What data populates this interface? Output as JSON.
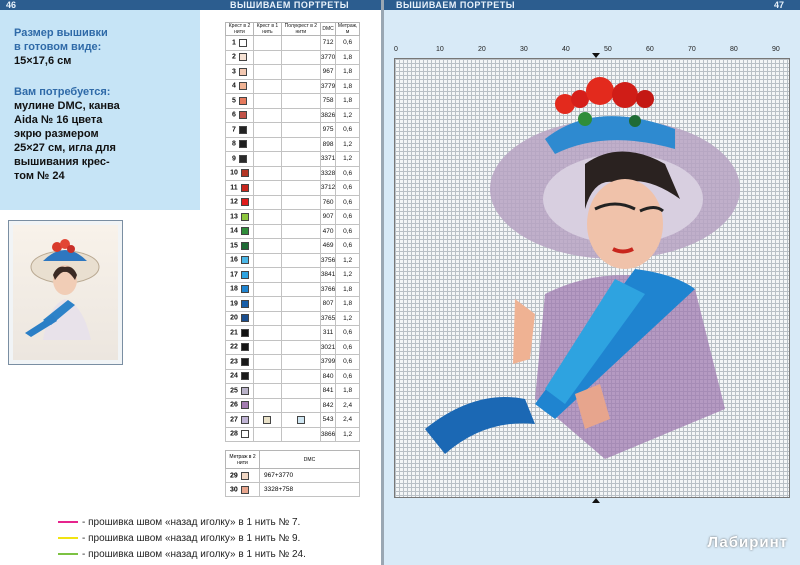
{
  "left_page": {
    "page_number": "46",
    "running_title": "ВЫШИВАЕМ ПОРТРЕТЫ",
    "info": {
      "size_title": "Размер вышивки",
      "size_sub": "в готовом виде:",
      "size_value": "15×17,6 см",
      "needs_title": "Вам потребуется:",
      "needs_lines": [
        "мулине DMC, канва",
        "Aida № 16 цвета",
        "экрю размером",
        "25×27 см, игла для",
        "вышивания крес-",
        "том № 24"
      ]
    },
    "key_headers": [
      "Крест в 2 нити",
      "Крест в 1 нить",
      "Полукрест в 2 нити",
      "DMC",
      "Метраж, м"
    ],
    "key_rows": [
      {
        "n": "1",
        "color": "#ffffff",
        "dmc": "712",
        "m": "0,6"
      },
      {
        "n": "2",
        "color": "#f6e2d4",
        "dmc": "3770",
        "m": "1,8"
      },
      {
        "n": "3",
        "color": "#f3c8b1",
        "dmc": "967",
        "m": "1,8"
      },
      {
        "n": "4",
        "color": "#efb293",
        "dmc": "3779",
        "m": "1,8"
      },
      {
        "n": "5",
        "color": "#e57a5d",
        "dmc": "758",
        "m": "1,8"
      },
      {
        "n": "6",
        "color": "#c25248",
        "dmc": "3826",
        "m": "1,2"
      },
      {
        "n": "7",
        "color": "#232323",
        "dmc": "975",
        "m": "0,6"
      },
      {
        "n": "8",
        "color": "#1e1e1e",
        "dmc": "898",
        "m": "1,2"
      },
      {
        "n": "9",
        "color": "#2a2a2a",
        "dmc": "3371",
        "m": "1,2"
      },
      {
        "n": "10",
        "color": "#b33524",
        "dmc": "3328",
        "m": "0,6"
      },
      {
        "n": "11",
        "color": "#c8261d",
        "dmc": "3712",
        "m": "0,6"
      },
      {
        "n": "12",
        "color": "#e01a1a",
        "dmc": "760",
        "m": "0,6"
      },
      {
        "n": "13",
        "color": "#8dc63f",
        "dmc": "907",
        "m": "0,6"
      },
      {
        "n": "14",
        "color": "#2f8d3a",
        "dmc": "470",
        "m": "0,6"
      },
      {
        "n": "15",
        "color": "#1f6b35",
        "dmc": "469",
        "m": "0,6"
      },
      {
        "n": "16",
        "color": "#4ab6e6",
        "dmc": "3756",
        "m": "1,2"
      },
      {
        "n": "17",
        "color": "#2ea3e0",
        "dmc": "3841",
        "m": "1,2"
      },
      {
        "n": "18",
        "color": "#1f84d0",
        "dmc": "3766",
        "m": "1,8"
      },
      {
        "n": "19",
        "color": "#175ea8",
        "dmc": "807",
        "m": "1,8"
      },
      {
        "n": "20",
        "color": "#1b4e8e",
        "dmc": "3765",
        "m": "1,2"
      },
      {
        "n": "21",
        "color": "#111111",
        "dmc": "311",
        "m": "0,6"
      },
      {
        "n": "22",
        "color": "#151515",
        "dmc": "3021",
        "m": "0,6"
      },
      {
        "n": "23",
        "color": "#181818",
        "dmc": "3799",
        "m": "0,6"
      },
      {
        "n": "24",
        "color": "#1a1a1a",
        "dmc": "840",
        "m": "0,6"
      },
      {
        "n": "25",
        "color": "#b9b2c8",
        "dmc": "841",
        "m": "1,8"
      },
      {
        "n": "26",
        "color": "#a37bb0",
        "dmc": "842",
        "m": "2,4"
      },
      {
        "n": "27",
        "color": "#bfb3d4",
        "dmc": "543",
        "m": "2,4"
      },
      {
        "n": "28",
        "color": "#ffffff",
        "dmc": "3866",
        "m": "1,2"
      }
    ],
    "key2_headers": [
      "Метраж в 2 нити",
      "DMC"
    ],
    "key2_rows": [
      {
        "n": "29",
        "color": "#f1d7c4",
        "dmc": "967+3770"
      },
      {
        "n": "30",
        "color": "#e7a58d",
        "dmc": "3328+758"
      }
    ],
    "legend": [
      {
        "color": "#e6248d",
        "text": "- прошивка швом «назад иголку» в 1 нить № 7."
      },
      {
        "color": "#f1e312",
        "text": "- прошивка швом «назад иголку» в 1 нить № 9."
      },
      {
        "color": "#7cc242",
        "text": "- прошивка швом «назад иголку» в 1 нить № 24."
      }
    ]
  },
  "right_page": {
    "page_number": "47",
    "running_title": "ВЫШИВАЕМ ПОРТРЕТЫ",
    "x_ticks": [
      "0",
      "10",
      "20",
      "30",
      "40",
      "50",
      "60",
      "70",
      "80",
      "90"
    ],
    "y_ticks": [
      "0",
      "10",
      "20",
      "30",
      "40",
      "50",
      "60",
      "70",
      "80",
      "90",
      "100"
    ],
    "watermark": "Лабиринт"
  }
}
